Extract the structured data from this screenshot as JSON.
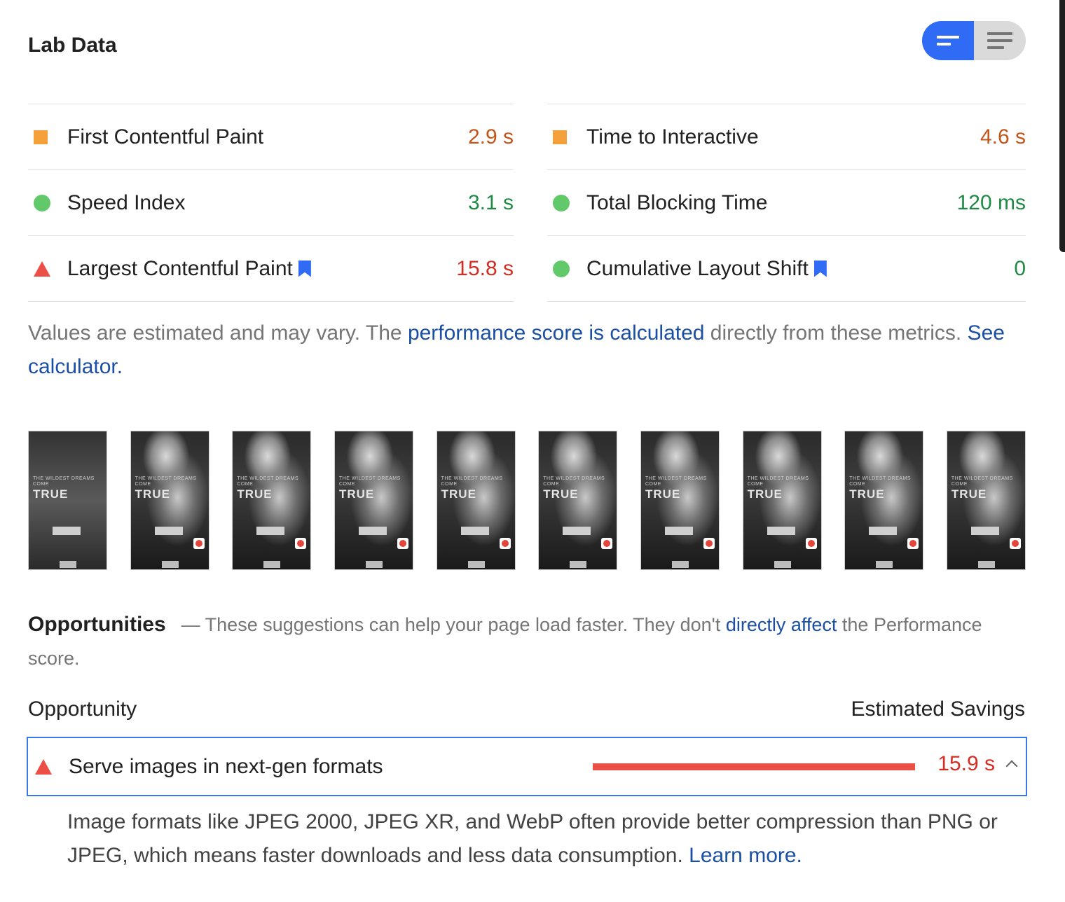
{
  "lab_data": {
    "title": "Lab Data",
    "view_toggle": [
      "list-summary-view-icon",
      "list-detail-view-icon"
    ]
  },
  "metrics": {
    "left": [
      {
        "name": "First Contentful Paint",
        "value": "2.9 s",
        "status": "average",
        "icon": "square-icon"
      },
      {
        "name": "Speed Index",
        "value": "3.1 s",
        "status": "pass",
        "icon": "circle-icon"
      },
      {
        "name": "Largest Contentful Paint",
        "value": "15.8 s",
        "status": "fail",
        "icon": "triangle-icon",
        "bookmark": true
      }
    ],
    "right": [
      {
        "name": "Time to Interactive",
        "value": "4.6 s",
        "status": "average",
        "icon": "square-icon"
      },
      {
        "name": "Total Blocking Time",
        "value": "120 ms",
        "status": "pass",
        "icon": "circle-icon"
      },
      {
        "name": "Cumulative Layout Shift",
        "value": "0",
        "status": "pass",
        "icon": "circle-icon",
        "bookmark": true
      }
    ]
  },
  "note": {
    "prefix": "Values are estimated and may vary. The ",
    "link1": "performance score is calculated",
    "middle": " directly from these metrics. ",
    "link2": "See calculator."
  },
  "filmstrip": {
    "frame_count": 10,
    "frame_text_small": "THE WILDEST DREAMS COME",
    "frame_text_big": "TRUE"
  },
  "opportunities": {
    "title": "Opportunities",
    "intro_prefix": "— These suggestions can help your page load faster. They don't ",
    "intro_link": "directly affect",
    "intro_suffix": " the Performance score.",
    "col_left": "Opportunity",
    "col_right": "Estimated Savings",
    "item": {
      "label": "Serve images in next-gen formats",
      "value": "15.9 s",
      "savings_fraction": 1.0
    },
    "description": "Image formats like JPEG 2000, JPEG XR, and WebP often provide better compression than PNG or JPEG, which means faster downloads and less data consumption. ",
    "learn_more": "Learn more."
  },
  "colors": {
    "average": "#c3551b",
    "pass": "#1f8a44",
    "fail": "#d42d24",
    "link": "#1a4fa3",
    "accent": "#2f6bf5"
  }
}
